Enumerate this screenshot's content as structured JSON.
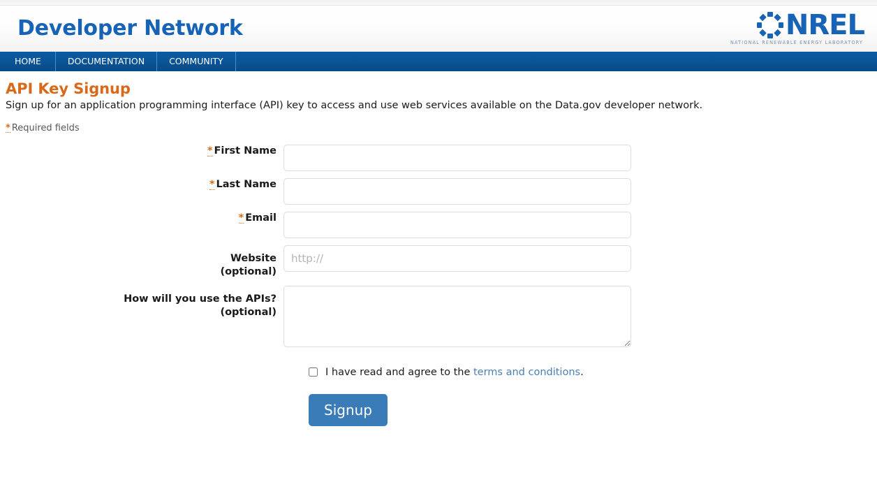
{
  "header": {
    "brand_title": "Developer Network",
    "logo": {
      "mark_name": "nrel-circular-mark",
      "wordmark": "NREL",
      "tagline": "NATIONAL RENEWABLE ENERGY LABORATORY",
      "color": "#1763b5"
    }
  },
  "nav": {
    "items": [
      {
        "label": "HOME"
      },
      {
        "label": "DOCUMENTATION"
      },
      {
        "label": "COMMUNITY"
      }
    ],
    "background_color": "#0a5396"
  },
  "page": {
    "title": "API Key Signup",
    "title_color": "#d9691a",
    "description": "Sign up for an application programming interface (API) key to access and use web services available on the Data.gov developer network.",
    "required_marker": "*",
    "required_note": "Required fields"
  },
  "form": {
    "fields": [
      {
        "id": "first-name",
        "label": "First Name",
        "required_marker": "*",
        "required": true,
        "value": "",
        "placeholder": ""
      },
      {
        "id": "last-name",
        "label": "Last Name",
        "required_marker": "*",
        "required": true,
        "value": "",
        "placeholder": ""
      },
      {
        "id": "email",
        "label": "Email",
        "required_marker": "*",
        "required": true,
        "value": "",
        "placeholder": ""
      },
      {
        "id": "website",
        "label": "Website",
        "sublabel": "(optional)",
        "required": false,
        "value": "",
        "placeholder": "http://"
      },
      {
        "id": "api-use",
        "label": "How will you use the APIs?",
        "sublabel": "(optional)",
        "required": false,
        "value": "",
        "placeholder": ""
      }
    ],
    "terms": {
      "checked": false,
      "text_before": "I have read and agree to the",
      "link_text": "terms and conditions",
      "text_after": ".",
      "link_color": "#4a7fb5"
    },
    "submit": {
      "label": "Signup",
      "color": "#3a7cb8"
    }
  }
}
